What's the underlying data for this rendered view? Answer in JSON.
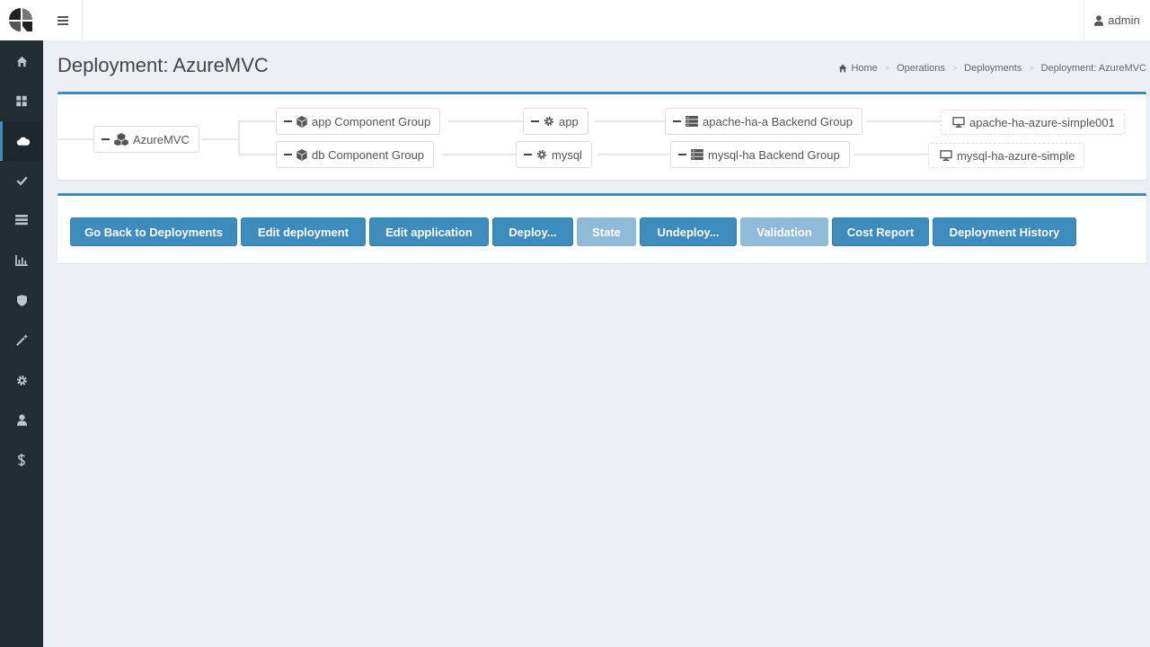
{
  "header": {
    "menu_icon": "bars-icon",
    "user_icon": "user-icon",
    "user_name": "admin"
  },
  "sidebar": {
    "items": [
      {
        "icon": "home-icon"
      },
      {
        "icon": "dashboard-icon"
      },
      {
        "icon": "cloud-icon",
        "active": true
      },
      {
        "icon": "check-icon"
      },
      {
        "icon": "list-icon"
      },
      {
        "icon": "bar-chart-icon"
      },
      {
        "icon": "shield-icon"
      },
      {
        "icon": "magic-wand-icon"
      },
      {
        "icon": "gear-icon"
      },
      {
        "icon": "user-icon"
      },
      {
        "icon": "dollar-icon"
      }
    ]
  },
  "page": {
    "title": "Deployment: AzureMVC"
  },
  "breadcrumb": {
    "items": [
      "Home",
      "Operations",
      "Deployments",
      "Deployment: AzureMVC"
    ]
  },
  "tree": {
    "root": "AzureMVC",
    "nodes": [
      "app Component Group",
      "db Component Group",
      "app",
      "mysql",
      "apache-ha-a Backend Group",
      "mysql-ha Backend Group",
      "apache-ha-azure-simple001",
      "mysql-ha-azure-simple"
    ]
  },
  "actions": {
    "buttons": [
      {
        "label": "Go Back to Deployments"
      },
      {
        "label": "Edit deployment"
      },
      {
        "label": "Edit application"
      },
      {
        "label": "Deploy..."
      },
      {
        "label": "State",
        "disabled": true
      },
      {
        "label": "Undeploy..."
      },
      {
        "label": "Validation",
        "disabled": true
      },
      {
        "label": "Cost Report"
      },
      {
        "label": "Deployment History"
      }
    ]
  },
  "colors": {
    "sidebar_bg": "#222d32",
    "accent": "#3c8dbc",
    "page_bg": "#ecf0f5"
  }
}
